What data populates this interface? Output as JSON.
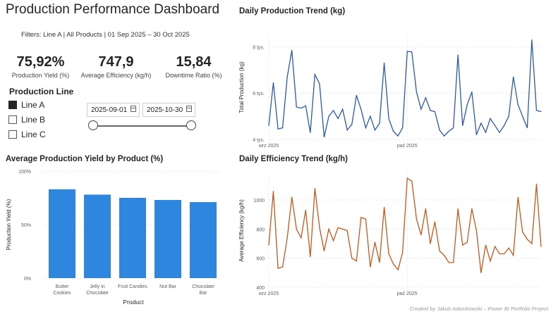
{
  "header": {
    "title": "Production Performance Dashboard",
    "filters": "Filters: Line A | All Products | 01 Sep 2025 – 30 Oct 2025"
  },
  "kpis": [
    {
      "value": "75,92%",
      "label": "Production Yield (%)"
    },
    {
      "value": "747,9",
      "label": "Average Efficiency (kg/h)"
    },
    {
      "value": "15,84",
      "label": "Downtime Ratio (%)"
    }
  ],
  "slicer": {
    "title": "Production Line",
    "items": [
      {
        "label": "Line A",
        "checked": true
      },
      {
        "label": "Line B",
        "checked": false
      },
      {
        "label": "Line C",
        "checked": false
      }
    ]
  },
  "date_range": {
    "start": "2025-09-01",
    "end": "2025-10-30",
    "icon": "calendar-icon"
  },
  "footer": "Created by Jakub Adamkowski – Power BI Portfolio Project",
  "colors": {
    "bar": "#2e86de",
    "production_line": "#2b5aa6",
    "efficiency_line": "#c4581b"
  },
  "chart_data": [
    {
      "type": "line",
      "title": "Daily Production Trend (kg)",
      "xlabel": "",
      "ylabel": "Total Production (kg)",
      "x_tick_labels": [
        "wrz 2025",
        "paź 2025"
      ],
      "y_tick_labels": [
        "4 tys.",
        "6 tys.",
        "8 tys."
      ],
      "y_ticks": [
        4000,
        6000,
        8000
      ],
      "ylim": [
        4000,
        8500
      ],
      "x": [
        "2025-09-01",
        "2025-09-02",
        "2025-09-03",
        "2025-09-04",
        "2025-09-05",
        "2025-09-06",
        "2025-09-07",
        "2025-09-08",
        "2025-09-09",
        "2025-09-10",
        "2025-09-11",
        "2025-09-12",
        "2025-09-13",
        "2025-09-14",
        "2025-09-15",
        "2025-09-16",
        "2025-09-17",
        "2025-09-18",
        "2025-09-19",
        "2025-09-20",
        "2025-09-21",
        "2025-09-22",
        "2025-09-23",
        "2025-09-24",
        "2025-09-25",
        "2025-09-26",
        "2025-09-27",
        "2025-09-28",
        "2025-09-29",
        "2025-09-30",
        "2025-10-01",
        "2025-10-02",
        "2025-10-03",
        "2025-10-04",
        "2025-10-05",
        "2025-10-06",
        "2025-10-07",
        "2025-10-08",
        "2025-10-09",
        "2025-10-10",
        "2025-10-11",
        "2025-10-12",
        "2025-10-13",
        "2025-10-14",
        "2025-10-15",
        "2025-10-16",
        "2025-10-17",
        "2025-10-18",
        "2025-10-19",
        "2025-10-20",
        "2025-10-21",
        "2025-10-22",
        "2025-10-23",
        "2025-10-24",
        "2025-10-25",
        "2025-10-26",
        "2025-10-27",
        "2025-10-28",
        "2025-10-29",
        "2025-10-30"
      ],
      "series": [
        {
          "values": [
            4600,
            6450,
            4450,
            4500,
            6700,
            7850,
            5400,
            5350,
            5450,
            4300,
            6800,
            6400,
            4100,
            5000,
            5250,
            4900,
            5300,
            4400,
            4650,
            5900,
            5300,
            4500,
            5000,
            4400,
            4700,
            7300,
            4900,
            4350,
            4150,
            4500,
            7800,
            7780,
            6050,
            5300,
            5800,
            5250,
            5200,
            4400,
            4150,
            4350,
            4500,
            7650,
            4600,
            5500,
            6050,
            4200,
            4700,
            4300,
            4900,
            4600,
            4300,
            4600,
            5000,
            6700,
            5500,
            5000,
            4500,
            8300,
            5250,
            5200
          ]
        }
      ]
    },
    {
      "type": "bar",
      "title": "Average Production Yield by Product (%)",
      "xlabel": "Product",
      "ylabel": "Production Yield (%)",
      "categories": [
        "Butter Cookies",
        "Jelly in Chocolate",
        "Fruit Candies",
        "Nut Bar",
        "Chocolate Bar"
      ],
      "category_labels": [
        [
          "Butter",
          "Cookies"
        ],
        [
          "Jelly in",
          "Chocolate"
        ],
        [
          "Fruit Candies"
        ],
        [
          "Nut Bar"
        ],
        [
          "Chocolate",
          "Bar"
        ]
      ],
      "values": [
        83,
        78,
        75,
        73,
        71
      ],
      "y_ticks": [
        0,
        50,
        100
      ],
      "y_tick_labels": [
        "0%",
        "50%",
        "100%"
      ],
      "ylim": [
        0,
        100
      ]
    },
    {
      "type": "line",
      "title": "Daily Efficiency Trend (kg/h)",
      "xlabel": "",
      "ylabel": "Average Efficiency (kg/h)",
      "x_tick_labels": [
        "wrz 2025",
        "paź 2025"
      ],
      "y_tick_labels": [
        "400",
        "600",
        "800",
        "1000"
      ],
      "y_ticks": [
        400,
        600,
        800,
        1000
      ],
      "ylim": [
        400,
        1180
      ],
      "x": [
        "2025-09-01",
        "2025-09-02",
        "2025-09-03",
        "2025-09-04",
        "2025-09-05",
        "2025-09-06",
        "2025-09-07",
        "2025-09-08",
        "2025-09-09",
        "2025-09-10",
        "2025-09-11",
        "2025-09-12",
        "2025-09-13",
        "2025-09-14",
        "2025-09-15",
        "2025-09-16",
        "2025-09-17",
        "2025-09-18",
        "2025-09-19",
        "2025-09-20",
        "2025-09-21",
        "2025-09-22",
        "2025-09-23",
        "2025-09-24",
        "2025-09-25",
        "2025-09-26",
        "2025-09-27",
        "2025-09-28",
        "2025-09-29",
        "2025-09-30",
        "2025-10-01",
        "2025-10-02",
        "2025-10-03",
        "2025-10-04",
        "2025-10-05",
        "2025-10-06",
        "2025-10-07",
        "2025-10-08",
        "2025-10-09",
        "2025-10-10",
        "2025-10-11",
        "2025-10-12",
        "2025-10-13",
        "2025-10-14",
        "2025-10-15",
        "2025-10-16",
        "2025-10-17",
        "2025-10-18",
        "2025-10-19",
        "2025-10-20",
        "2025-10-21",
        "2025-10-22",
        "2025-10-23",
        "2025-10-24",
        "2025-10-25",
        "2025-10-26",
        "2025-10-27",
        "2025-10-28",
        "2025-10-29",
        "2025-10-30"
      ],
      "series": [
        {
          "values": [
            690,
            1060,
            530,
            540,
            740,
            1020,
            800,
            740,
            930,
            610,
            1080,
            810,
            650,
            800,
            720,
            810,
            800,
            790,
            600,
            580,
            880,
            870,
            540,
            710,
            570,
            950,
            630,
            560,
            520,
            640,
            1150,
            1130,
            870,
            760,
            940,
            700,
            850,
            650,
            620,
            570,
            570,
            940,
            690,
            710,
            940,
            790,
            500,
            690,
            580,
            680,
            630,
            630,
            670,
            620,
            1020,
            780,
            730,
            700,
            1110,
            680
          ]
        }
      ]
    }
  ]
}
